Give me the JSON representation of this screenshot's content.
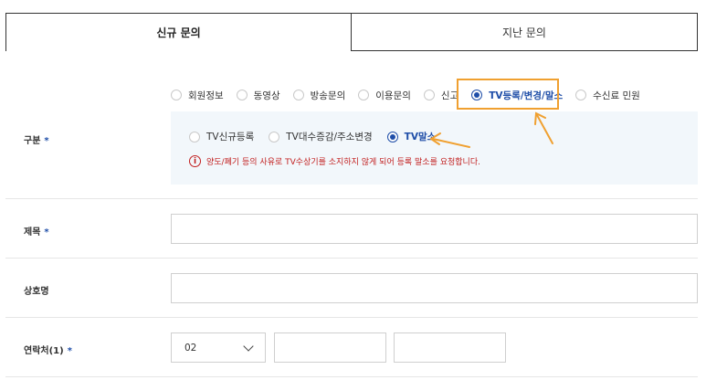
{
  "tabs": {
    "active": "신규 문의",
    "inactive": "지난 문의"
  },
  "category": {
    "label": "구분",
    "required_mark": "*",
    "options": [
      {
        "label": "회원정보",
        "checked": false
      },
      {
        "label": "동영상",
        "checked": false
      },
      {
        "label": "방송문의",
        "checked": false
      },
      {
        "label": "이용문의",
        "checked": false
      },
      {
        "label": "신고",
        "checked": false
      },
      {
        "label": "TV등록/변경/말소",
        "checked": true
      },
      {
        "label": "수신료 민원",
        "checked": false
      }
    ],
    "sub_options": [
      {
        "label": "TV신규등록",
        "checked": false
      },
      {
        "label": "TV대수증감/주소변경",
        "checked": false
      },
      {
        "label": "TV말소",
        "checked": true
      }
    ],
    "notice_icon": "i",
    "notice": "양도/폐기 등의 사유로 TV수상기를 소지하지 않게 되어 등록 말소를 요청합니다."
  },
  "title_field": {
    "label": "제목",
    "required_mark": "*",
    "value": ""
  },
  "company_field": {
    "label": "상호명",
    "value": ""
  },
  "contact_field": {
    "label": "연락처(1)",
    "required_mark": "*",
    "area_code": "02",
    "middle": "",
    "last": ""
  },
  "colors": {
    "accent": "#1f4ea8",
    "highlight": "#f0a030",
    "notice": "#c21f1f"
  }
}
